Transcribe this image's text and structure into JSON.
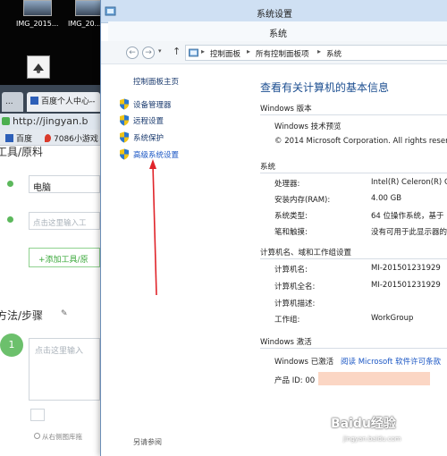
{
  "desktop": {
    "icons": [
      {
        "label": "IMG_2015..."
      },
      {
        "label": "IMG_20..."
      }
    ]
  },
  "browser": {
    "tabs": [
      {
        "label": "..."
      },
      {
        "label": "百度个人中心--"
      }
    ],
    "address": "http://jingyan.b",
    "bookmarks": [
      {
        "label": "百度"
      },
      {
        "label": "7086小游戏"
      }
    ],
    "page": {
      "section_tools": "工具/原料",
      "tool_value": "电脑",
      "tool_placeholder": "点击这里输入工",
      "add_tool_button": "+添加工具/原",
      "section_steps": "方法/步骤",
      "step_number": "1",
      "step_placeholder": "点击这里输入",
      "upload_hint": "从右侧图库拖"
    }
  },
  "window": {
    "outer_title": "系统设置",
    "inner_title": "系统",
    "breadcrumbs": [
      "控制面板",
      "所有控制面板项",
      "系统"
    ],
    "left_pane": {
      "home_link": "控制面板主页",
      "tasks": [
        {
          "label": "设备管理器"
        },
        {
          "label": "远程设置"
        },
        {
          "label": "系统保护"
        },
        {
          "label": "高级系统设置"
        }
      ],
      "see_also": "另请参阅"
    },
    "main": {
      "heading": "查看有关计算机的基本信息",
      "windows_edition": {
        "title": "Windows 版本",
        "name": "Windows 技术预览",
        "copyright": "© 2014 Microsoft Corporation. All rights reserved."
      },
      "system": {
        "title": "系统",
        "rows": [
          {
            "key": "处理器:",
            "value": "Intel(R) Celeron(R) C"
          },
          {
            "key": "安装内存(RAM):",
            "value": "4.00 GB"
          },
          {
            "key": "系统类型:",
            "value": "64 位操作系统，基于"
          },
          {
            "key": "笔和触摸:",
            "value": "没有可用于此显示器的"
          }
        ]
      },
      "computer_name": {
        "title": "计算机名、域和工作组设置",
        "rows": [
          {
            "key": "计算机名:",
            "value": "MI-201501231929"
          },
          {
            "key": "计算机全名:",
            "value": "MI-201501231929"
          },
          {
            "key": "计算机描述:",
            "value": ""
          },
          {
            "key": "工作组:",
            "value": "WorkGroup"
          }
        ]
      },
      "activation": {
        "title": "Windows 激活",
        "status": "Windows 已激活",
        "license_link": "阅读 Microsoft 软件许可条款",
        "product_id_label": "产品 ID: 00"
      }
    }
  },
  "watermark": {
    "logo": "Baidu经验",
    "url": "jingyan.baidu.com"
  },
  "colors": {
    "accent_link": "#1a56c4",
    "heading_blue": "#1d4f91",
    "annotation_red": "#e0242a",
    "titlebar": "#cfe0f3"
  }
}
